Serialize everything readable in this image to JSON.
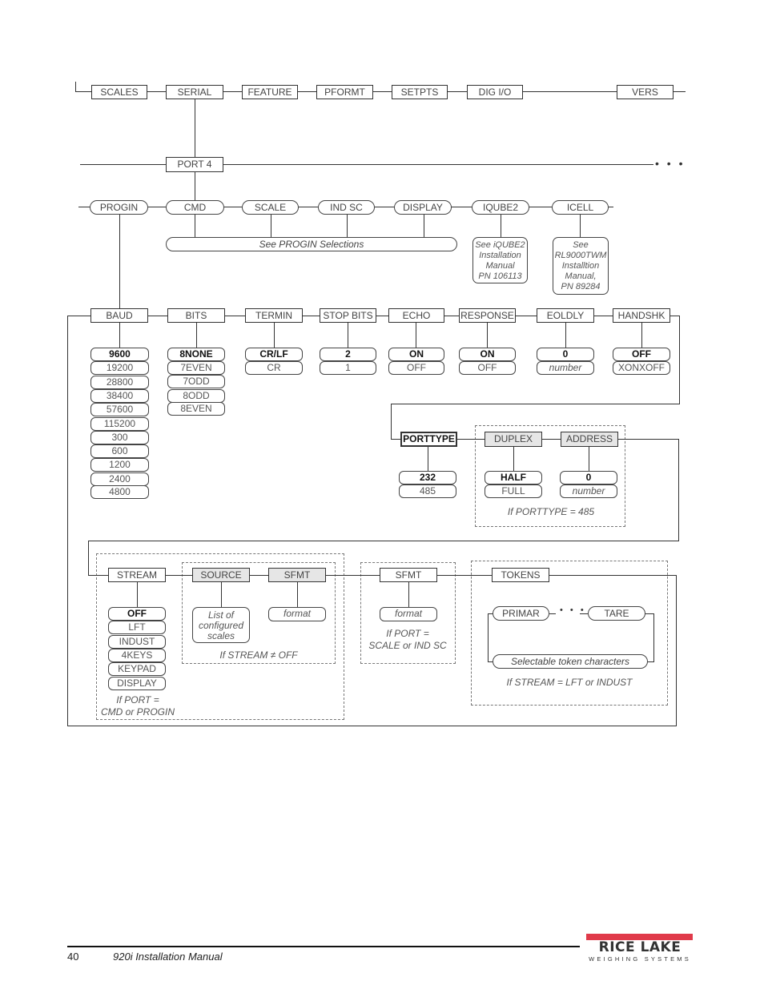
{
  "menu_level1": [
    "SCALES",
    "SERIAL",
    "FEATURE",
    "PFORMT",
    "SETPTS",
    "DIG I/O",
    "VERS"
  ],
  "port": {
    "label": "PORT 4",
    "more": "• • •"
  },
  "port_modes": [
    "PROGIN",
    "CMD",
    "SCALE",
    "IND SC",
    "DISPLAY",
    "IQUBE2",
    "ICELL"
  ],
  "progin_note": "See PROGIN Selections",
  "iqube2_note": [
    "See iQUBE2",
    "Installation",
    "Manual",
    "PN 106113"
  ],
  "icell_note": [
    "See",
    "RL9000TWM",
    "Installtion",
    "Manual,",
    "PN 89284"
  ],
  "params": {
    "baud": {
      "label": "BAUD",
      "options": [
        "9600",
        "19200",
        "28800",
        "38400",
        "57600",
        "115200",
        "300",
        "600",
        "1200",
        "2400",
        "4800"
      ],
      "default": "9600"
    },
    "bits": {
      "label": "BITS",
      "options": [
        "8NONE",
        "7EVEN",
        "7ODD",
        "8ODD",
        "8EVEN"
      ],
      "default": "8NONE"
    },
    "termin": {
      "label": "TERMIN",
      "options": [
        "CR/LF",
        "CR"
      ],
      "default": "CR/LF"
    },
    "stop_bits": {
      "label": "STOP BITS",
      "options": [
        "2",
        "1"
      ],
      "default": "2"
    },
    "echo": {
      "label": "ECHO",
      "options": [
        "ON",
        "OFF"
      ],
      "default": "ON"
    },
    "response": {
      "label": "RESPONSE",
      "options": [
        "ON",
        "OFF"
      ],
      "default": "ON"
    },
    "eoldly": {
      "label": "EOLDLY",
      "options": [
        "0",
        "number"
      ],
      "default": "0"
    },
    "handshk": {
      "label": "HANDSHK",
      "options": [
        "OFF",
        "XONXOFF"
      ],
      "default": "OFF"
    }
  },
  "porttype": {
    "label": "PORTTYPE",
    "options": [
      "232",
      "485"
    ],
    "default": "232"
  },
  "duplex": {
    "label": "DUPLEX",
    "options": [
      "HALF",
      "FULL"
    ],
    "default": "HALF"
  },
  "address": {
    "label": "ADDRESS",
    "options": [
      "0",
      "number"
    ],
    "default": "0"
  },
  "rs485_condition": "If PORTTYPE = 485",
  "stream": {
    "label": "STREAM",
    "options": [
      "OFF",
      "LFT",
      "INDUST",
      "4KEYS",
      "KEYPAD",
      "DISPLAY"
    ],
    "default": "OFF",
    "condition": [
      "If PORT =",
      "CMD or PROGIN"
    ]
  },
  "source": {
    "label": "SOURCE",
    "note": [
      "List of",
      "configured",
      "scales"
    ]
  },
  "sfmt_stream": {
    "label": "SFMT",
    "value": "format"
  },
  "stream_on_condition": "If STREAM ≠ OFF",
  "sfmt_scale": {
    "label": "SFMT",
    "value": "format",
    "condition": [
      "If PORT =",
      "SCALE or IND SC"
    ]
  },
  "tokens": {
    "label": "TOKENS",
    "first": "PRIMAR",
    "ellipsis": "• • •",
    "last": "TARE",
    "characters": "Selectable token characters",
    "condition": "If STREAM  =  LFT or INDUST"
  },
  "footer": {
    "page_number": "40",
    "manual_title": "920i Installation Manual"
  },
  "logo": {
    "name": "RICE LAKE",
    "tagline": "WEIGHING SYSTEMS",
    "accent_color": "#e03a4a"
  }
}
